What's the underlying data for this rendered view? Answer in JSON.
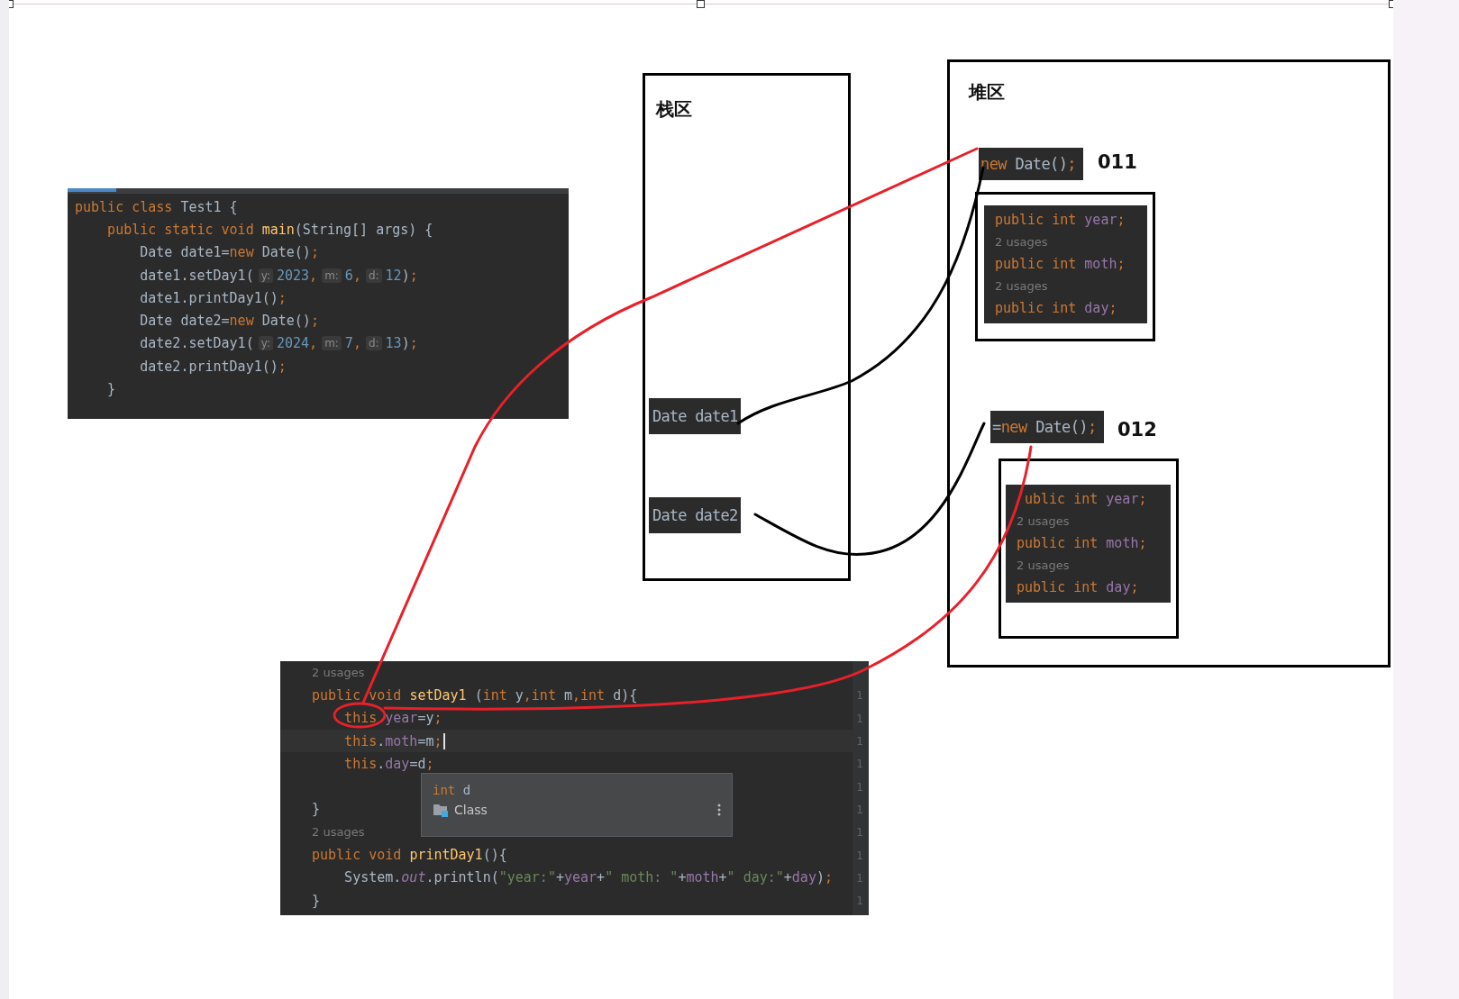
{
  "main_code": {
    "lines": [
      {
        "kind": "code",
        "tokens": [
          {
            "kind": "kw",
            "text": "public class "
          },
          {
            "kind": "plain",
            "text": "Test1 {"
          }
        ]
      },
      {
        "kind": "code",
        "tokens": [
          {
            "kind": "kw",
            "text": "    public static void "
          },
          {
            "kind": "method",
            "text": "main"
          },
          {
            "kind": "plain",
            "text": "(String[] args) {"
          }
        ]
      },
      {
        "kind": "code",
        "tokens": [
          {
            "kind": "plain",
            "text": "        Date date1="
          },
          {
            "kind": "kw",
            "text": "new "
          },
          {
            "kind": "plain",
            "text": "Date()"
          },
          {
            "kind": "kw",
            "text": ";"
          }
        ]
      },
      {
        "kind": "code",
        "tokens": [
          {
            "kind": "plain",
            "text": "        date1.setDay1("
          },
          {
            "kind": "hint",
            "text": "y:"
          },
          {
            "kind": "num",
            "text": "2023"
          },
          {
            "kind": "kw",
            "text": ","
          },
          {
            "kind": "hint",
            "text": "m:"
          },
          {
            "kind": "num",
            "text": "6"
          },
          {
            "kind": "kw",
            "text": ","
          },
          {
            "kind": "hint",
            "text": "d:"
          },
          {
            "kind": "num",
            "text": "12"
          },
          {
            "kind": "plain",
            "text": ")"
          },
          {
            "kind": "kw",
            "text": ";"
          }
        ]
      },
      {
        "kind": "code",
        "tokens": [
          {
            "kind": "plain",
            "text": "        date1.printDay1()"
          },
          {
            "kind": "kw",
            "text": ";"
          }
        ]
      },
      {
        "kind": "code",
        "tokens": [
          {
            "kind": "plain",
            "text": "        Date date2="
          },
          {
            "kind": "kw",
            "text": "new "
          },
          {
            "kind": "plain",
            "text": "Date()"
          },
          {
            "kind": "kw",
            "text": ";"
          }
        ]
      },
      {
        "kind": "code",
        "tokens": [
          {
            "kind": "plain",
            "text": "        date2.setDay1("
          },
          {
            "kind": "hint",
            "text": "y:"
          },
          {
            "kind": "num",
            "text": "2024"
          },
          {
            "kind": "kw",
            "text": ","
          },
          {
            "kind": "hint",
            "text": "m:"
          },
          {
            "kind": "num",
            "text": "7"
          },
          {
            "kind": "kw",
            "text": ","
          },
          {
            "kind": "hint",
            "text": "d:"
          },
          {
            "kind": "num",
            "text": "13"
          },
          {
            "kind": "plain",
            "text": ")"
          },
          {
            "kind": "kw",
            "text": ";"
          }
        ]
      },
      {
        "kind": "code",
        "tokens": [
          {
            "kind": "plain",
            "text": "        date2.printDay1()"
          },
          {
            "kind": "kw",
            "text": ";"
          }
        ]
      },
      {
        "kind": "code",
        "tokens": [
          {
            "kind": "plain",
            "text": "    }"
          }
        ]
      }
    ]
  },
  "stack": {
    "title": "栈区",
    "vars": [
      "Date date1",
      "Date date2"
    ]
  },
  "heap": {
    "title": "堆区",
    "objects": [
      {
        "ref": [
          {
            "kind": "kw",
            "text": "new "
          },
          {
            "kind": "plain",
            "text": "Date()"
          },
          {
            "kind": "kw",
            "text": ";"
          }
        ],
        "address": "011",
        "fields": [
          {
            "kind": "code",
            "tokens": [
              {
                "kind": "kw",
                "text": "public int "
              },
              {
                "kind": "field",
                "text": "year"
              },
              {
                "kind": "kw",
                "text": ";"
              }
            ]
          },
          {
            "kind": "usages",
            "text": "2 usages"
          },
          {
            "kind": "code",
            "tokens": [
              {
                "kind": "kw",
                "text": "public int "
              },
              {
                "kind": "field",
                "text": "moth"
              },
              {
                "kind": "kw",
                "text": ";"
              }
            ]
          },
          {
            "kind": "usages",
            "text": "2 usages"
          },
          {
            "kind": "code",
            "tokens": [
              {
                "kind": "kw",
                "text": "public int "
              },
              {
                "kind": "field",
                "text": "day"
              },
              {
                "kind": "kw",
                "text": ";"
              }
            ]
          }
        ]
      },
      {
        "ref": [
          {
            "kind": "plain",
            "text": "="
          },
          {
            "kind": "kw",
            "text": "new "
          },
          {
            "kind": "plain",
            "text": "Date()"
          },
          {
            "kind": "kw",
            "text": ";"
          }
        ],
        "address": "012",
        "fields": [
          {
            "kind": "code",
            "tokens": [
              {
                "kind": "gap"
              },
              {
                "kind": "kw",
                "text": "ublic int "
              },
              {
                "kind": "field",
                "text": "year"
              },
              {
                "kind": "kw",
                "text": ";"
              }
            ]
          },
          {
            "kind": "usages",
            "text": "2 usages"
          },
          {
            "kind": "code",
            "tokens": [
              {
                "kind": "kw",
                "text": "public int "
              },
              {
                "kind": "field",
                "text": "moth"
              },
              {
                "kind": "kw",
                "text": ";"
              }
            ]
          },
          {
            "kind": "usages",
            "text": "2 usages"
          },
          {
            "kind": "code",
            "tokens": [
              {
                "kind": "kw",
                "text": "public int "
              },
              {
                "kind": "field",
                "text": "day"
              },
              {
                "kind": "kw",
                "text": ";"
              }
            ]
          }
        ]
      }
    ]
  },
  "method_code": {
    "lines": [
      {
        "kind": "usages",
        "text": "2 usages"
      },
      {
        "kind": "code",
        "current": false,
        "gutter": "1",
        "tokens": [
          {
            "kind": "kw",
            "text": "public void "
          },
          {
            "kind": "method",
            "text": "setDay1 "
          },
          {
            "kind": "plain",
            "text": "("
          },
          {
            "kind": "kw",
            "text": "int "
          },
          {
            "kind": "plain",
            "text": "y"
          },
          {
            "kind": "kw",
            "text": ","
          },
          {
            "kind": "kw",
            "text": "int "
          },
          {
            "kind": "plain",
            "text": "m"
          },
          {
            "kind": "kw",
            "text": ","
          },
          {
            "kind": "kw",
            "text": "int "
          },
          {
            "kind": "plain",
            "text": "d){"
          }
        ]
      },
      {
        "kind": "code",
        "current": false,
        "gutter": "1",
        "tokens": [
          {
            "kind": "kw",
            "text": "    this "
          },
          {
            "kind": "field",
            "text": "year"
          },
          {
            "kind": "plain",
            "text": "=y"
          },
          {
            "kind": "kw",
            "text": ";"
          }
        ]
      },
      {
        "kind": "code",
        "current": true,
        "gutter": "1",
        "tokens": [
          {
            "kind": "kw",
            "text": "    this"
          },
          {
            "kind": "plain",
            "text": "."
          },
          {
            "kind": "field",
            "text": "moth"
          },
          {
            "kind": "plain",
            "text": "=m"
          },
          {
            "kind": "kw",
            "text": ";"
          }
        ]
      },
      {
        "kind": "code",
        "current": false,
        "gutter": "1",
        "tokens": [
          {
            "kind": "kw",
            "text": "    this"
          },
          {
            "kind": "plain",
            "text": "."
          },
          {
            "kind": "field",
            "text": "day"
          },
          {
            "kind": "plain",
            "text": "=d"
          },
          {
            "kind": "kw",
            "text": ";"
          }
        ]
      },
      {
        "kind": "blank",
        "gutter": "1"
      },
      {
        "kind": "code",
        "current": false,
        "gutter": "1",
        "tokens": [
          {
            "kind": "plain",
            "text": "}"
          }
        ]
      },
      {
        "kind": "usages",
        "text": "2 usages",
        "gutter": "1"
      },
      {
        "kind": "code",
        "current": false,
        "gutter": "1",
        "tokens": [
          {
            "kind": "kw",
            "text": "public void "
          },
          {
            "kind": "method",
            "text": "printDay1"
          },
          {
            "kind": "plain",
            "text": "(){"
          }
        ]
      },
      {
        "kind": "code",
        "current": false,
        "gutter": "1",
        "tokens": [
          {
            "kind": "plain",
            "text": "    System."
          },
          {
            "kind": "static",
            "text": "out"
          },
          {
            "kind": "plain",
            "text": ".println("
          },
          {
            "kind": "str",
            "text": "\"year:\""
          },
          {
            "kind": "plain",
            "text": "+"
          },
          {
            "kind": "field",
            "text": "year"
          },
          {
            "kind": "plain",
            "text": "+"
          },
          {
            "kind": "str",
            "text": "\" moth: \""
          },
          {
            "kind": "plain",
            "text": "+"
          },
          {
            "kind": "field",
            "text": "moth"
          },
          {
            "kind": "plain",
            "text": "+"
          },
          {
            "kind": "str",
            "text": "\" day:\""
          },
          {
            "kind": "plain",
            "text": "+"
          },
          {
            "kind": "field",
            "text": "day"
          },
          {
            "kind": "plain",
            "text": ")"
          },
          {
            "kind": "kw",
            "text": ";"
          }
        ]
      },
      {
        "kind": "code",
        "current": false,
        "gutter": "1",
        "tokens": [
          {
            "kind": "plain",
            "text": "}"
          }
        ]
      }
    ],
    "popup": {
      "signature": [
        {
          "kind": "kw",
          "text": "int "
        },
        {
          "kind": "plain",
          "text": "d"
        }
      ],
      "item": "Class"
    }
  }
}
